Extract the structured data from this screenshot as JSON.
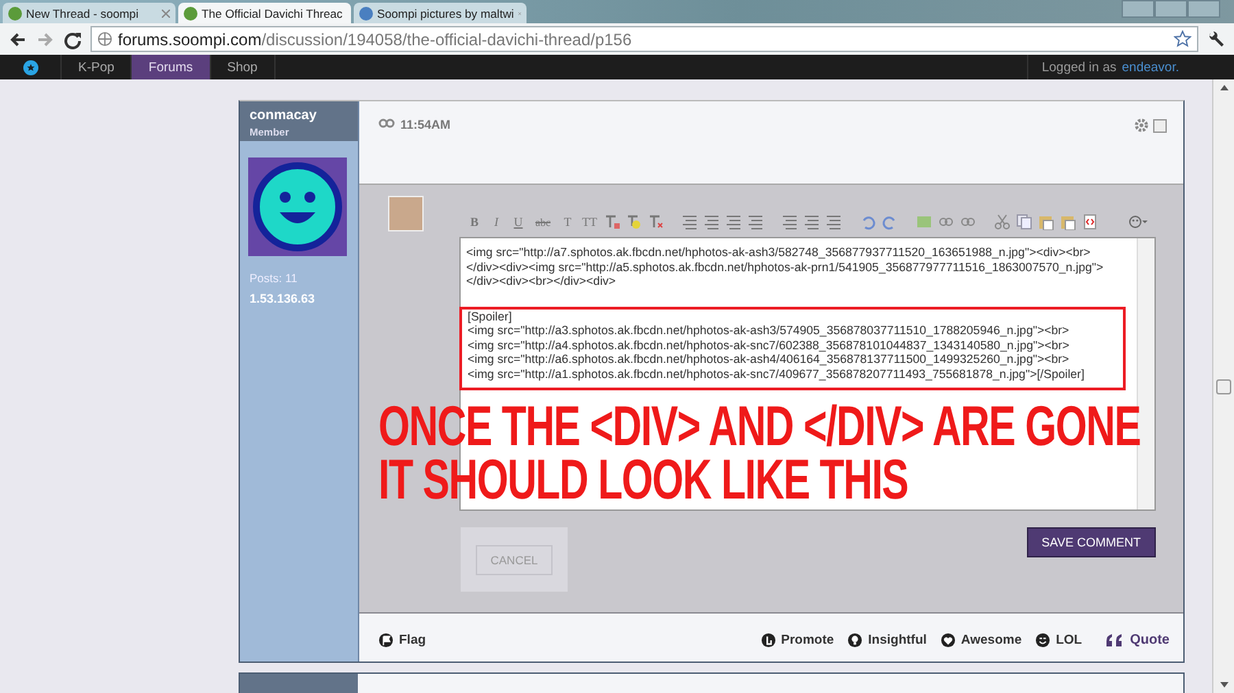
{
  "browser": {
    "tabs": [
      {
        "title": "New Thread - soompi",
        "selected": false
      },
      {
        "title": "The Official Davichi Threac",
        "selected": true
      },
      {
        "title": "Soompi pictures by maltwi",
        "selected": false
      }
    ],
    "url_host": "forums.soompi.com",
    "url_path": "/discussion/194058/the-official-davichi-thread/p156"
  },
  "site_nav": {
    "items": [
      {
        "label": "K-Pop",
        "selected": false
      },
      {
        "label": "Forums",
        "selected": true
      },
      {
        "label": "Shop",
        "selected": false
      }
    ],
    "login_text": "Logged in as",
    "username": "endeavor."
  },
  "post": {
    "author": "conmacay",
    "role": "Member",
    "posts": "Posts: 11",
    "ip": "1.53.136.63",
    "time": "11:54AM",
    "selected": false,
    "editor": {
      "toolbar": [
        "B",
        "I",
        "U",
        "abc",
        "T",
        "TT"
      ],
      "lines": [
        "<img src=\"http://a7.sphotos.ak.fbcdn.net/hphotos-ak-ash3/582748_356877937711520_163651988_n.jpg\"><div><br>",
        "</div><div><img src=\"http://a5.sphotos.ak.fbcdn.net/hphotos-ak-prn1/541905_356877977711516_1863007570_n.jpg\">",
        "</div><div><br></div><div>"
      ],
      "spoiler_lines": [
        "[Spoiler]",
        "<img src=\"http://a3.sphotos.ak.fbcdn.net/hphotos-ak-ash3/574905_356878037711510_1788205946_n.jpg\"><br>",
        "<img src=\"http://a4.sphotos.ak.fbcdn.net/hphotos-ak-snc7/602388_356878101044837_1343140580_n.jpg\"><br>",
        "<img src=\"http://a6.sphotos.ak.fbcdn.net/hphotos-ak-ash4/406164_356878137711500_1499325260_n.jpg\"><br>",
        "<img src=\"http://a1.sphotos.ak.fbcdn.net/hphotos-ak-snc7/409677_356878207711493_755681878_n.jpg\">[/Spoiler]"
      ]
    },
    "cancel": "CANCEL",
    "save": "SAVE COMMENT",
    "footer": {
      "flag": "Flag",
      "reactions": [
        "Promote",
        "Insightful",
        "Awesome",
        "LOL"
      ],
      "quote": "Quote"
    }
  },
  "annotation": {
    "lines": [
      "ONCE THE <DIV> AND </DIV> ARE GONE",
      "IT SHOULD LOOK LIKE THIS"
    ]
  }
}
